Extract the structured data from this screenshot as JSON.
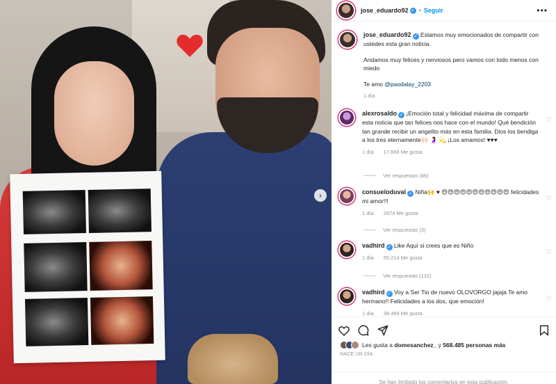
{
  "header": {
    "username": "jose_eduardo92",
    "separator": "•",
    "follow_label": "Seguir",
    "more_label": "•••"
  },
  "caption": {
    "username": "jose_eduardo92",
    "text_1": "Estamos muy emocionados de compartir con ustedes esta gran noticia.",
    "text_2": "Andamos muy felices y nerviosos pero vamos con todo menos con miedo",
    "text_3_prefix": "Te amo",
    "mention": "@paodalay_2203",
    "time": "1 día"
  },
  "comments": [
    {
      "username": "alexrosaldo",
      "verified": true,
      "text": "¡Emoción total y felicidad máxima de compartir esta noticia que tan felices nos hace con el mundo! Qué bendición tan grande recibir un angelito más en esta familia. Dios los bendiga a los tres eternamente🙌🏻 🤰🏻 💫 ¡Los amamos! ♥♥♥",
      "time": "1 día",
      "likes": "17.666 Me gusta",
      "replies": "Ver respuestas (46)"
    },
    {
      "username": "consueloduval",
      "verified": true,
      "text": "Niña🙌 ♥ 😍😍😍😍😍😍😍😍😍😍😍 felicidades mi amor!!!",
      "time": "1 día",
      "likes": "2674 Me gusta",
      "replies": "Ver respuestas (3)"
    },
    {
      "username": "vadhird",
      "verified": true,
      "text": "Like Aquí si crees que es Niño",
      "time": "1 día",
      "likes": "55.214 Me gusta",
      "replies": "Ver respuestas (132)"
    },
    {
      "username": "vadhird",
      "verified": true,
      "text": "Voy a Ser Tio de nuevo OLOVORGO jajaja Te amo hermano!! Felicidades a los dos, que emoción!",
      "time": "1 día",
      "likes": "38.494 Me gusta",
      "replies": ""
    }
  ],
  "likes": {
    "prefix": "Les gusta a",
    "user": "domesanchez_",
    "middle": "y",
    "count": "568.485 personas más"
  },
  "posted_ago": "HACE UN DÍA",
  "comments_limited": "Se han limitado los comentarios en esta publicación.",
  "icons": [
    "heart-icon",
    "comment-icon",
    "share-icon",
    "bookmark-icon",
    "chevron-right-icon",
    "verified-icon",
    "more-icon"
  ],
  "colors": {
    "verified": "#3897f0",
    "follow": "#0095f6",
    "heart": "#ed4956",
    "muted": "#8e8e8e"
  }
}
